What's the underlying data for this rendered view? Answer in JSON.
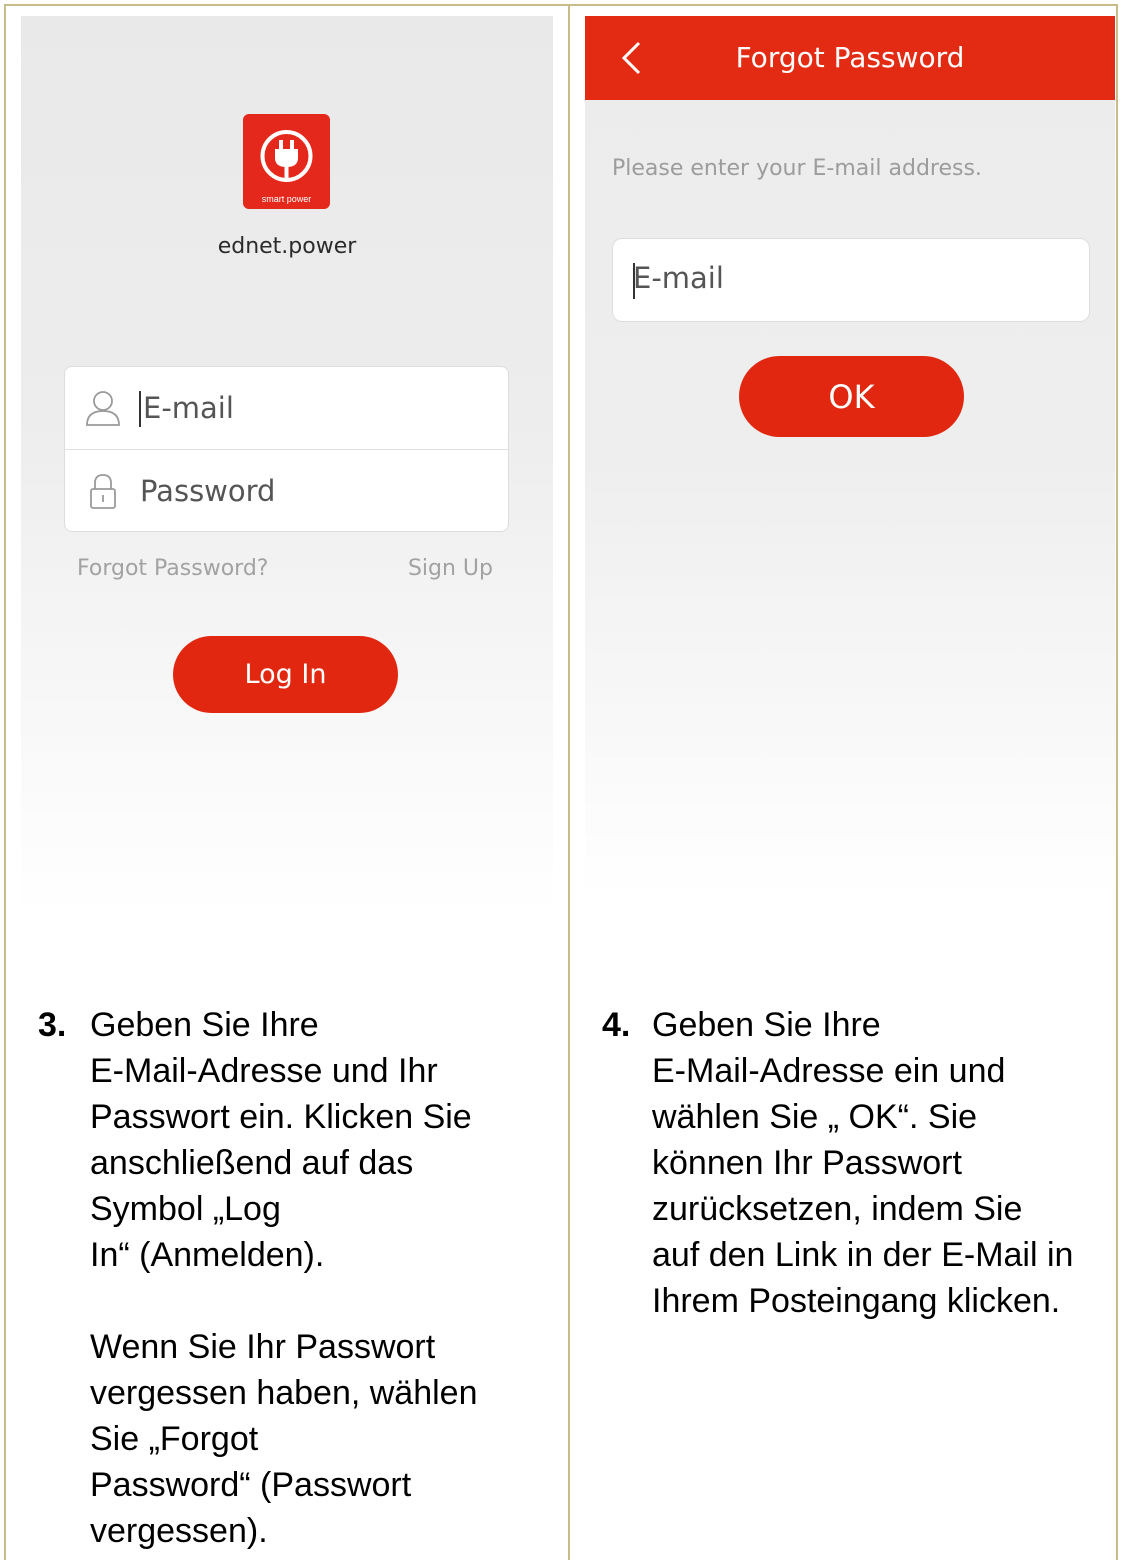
{
  "left_screen": {
    "logo_caption": "smart power",
    "app_name": "ednet.power",
    "email_placeholder": "E-mail",
    "password_placeholder": "Password",
    "forgot_link": "Forgot Password?",
    "signup_link": "Sign Up",
    "login_button": "Log In"
  },
  "right_screen": {
    "header_title": "Forgot Password",
    "instruction": "Please enter your E-mail address.",
    "email_placeholder": "E-mail",
    "ok_button": "OK"
  },
  "steps": [
    {
      "number": "3.",
      "paragraphs": [
        [
          "Geben Sie Ihre",
          "E-Mail-Adresse und Ihr",
          "Passwort ein. Klicken Sie",
          "anschließend auf das",
          "Symbol „Log",
          "In“ (Anmelden)."
        ],
        [
          "Wenn Sie Ihr Passwort",
          "vergessen haben, wählen",
          "Sie „Forgot",
          "Password“ (Passwort",
          "vergessen)."
        ]
      ]
    },
    {
      "number": "4.",
      "paragraphs": [
        [
          "Geben Sie Ihre",
          "E-Mail-Adresse ein und",
          "wählen Sie „ OK“. Sie",
          "können Ihr Passwort",
          "zurücksetzen, indem Sie",
          "auf den Link in der E-Mail in",
          "Ihrem Posteingang klicken."
        ]
      ]
    }
  ],
  "colors": {
    "accent_red": "#e1270f",
    "frame_border": "#c8bc8a"
  }
}
